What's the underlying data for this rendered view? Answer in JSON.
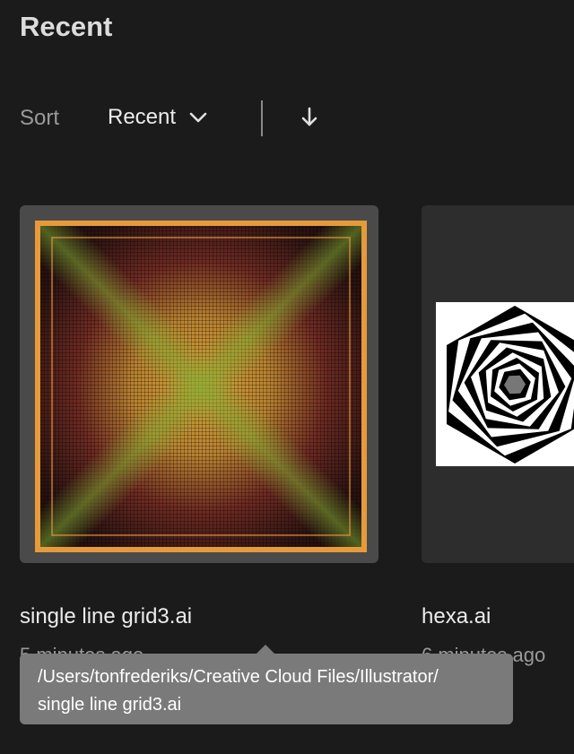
{
  "header": {
    "title": "Recent"
  },
  "sort": {
    "label": "Sort",
    "selected": "Recent",
    "direction": "descending"
  },
  "files": [
    {
      "name": "single line grid3.ai",
      "modified": "5 minutes ago"
    },
    {
      "name": "hexa.ai",
      "modified": "6 minutes ago"
    }
  ],
  "tooltip": {
    "line1": "/Users/tonfrederiks/Creative Cloud Files/Illustrator/",
    "line2": "single line grid3.ai"
  },
  "colors": {
    "background": "#1b1b1b",
    "card": "#4a4a4a",
    "tooltip": "#7a7a7a",
    "thumb_frame": "#e79a3b"
  }
}
